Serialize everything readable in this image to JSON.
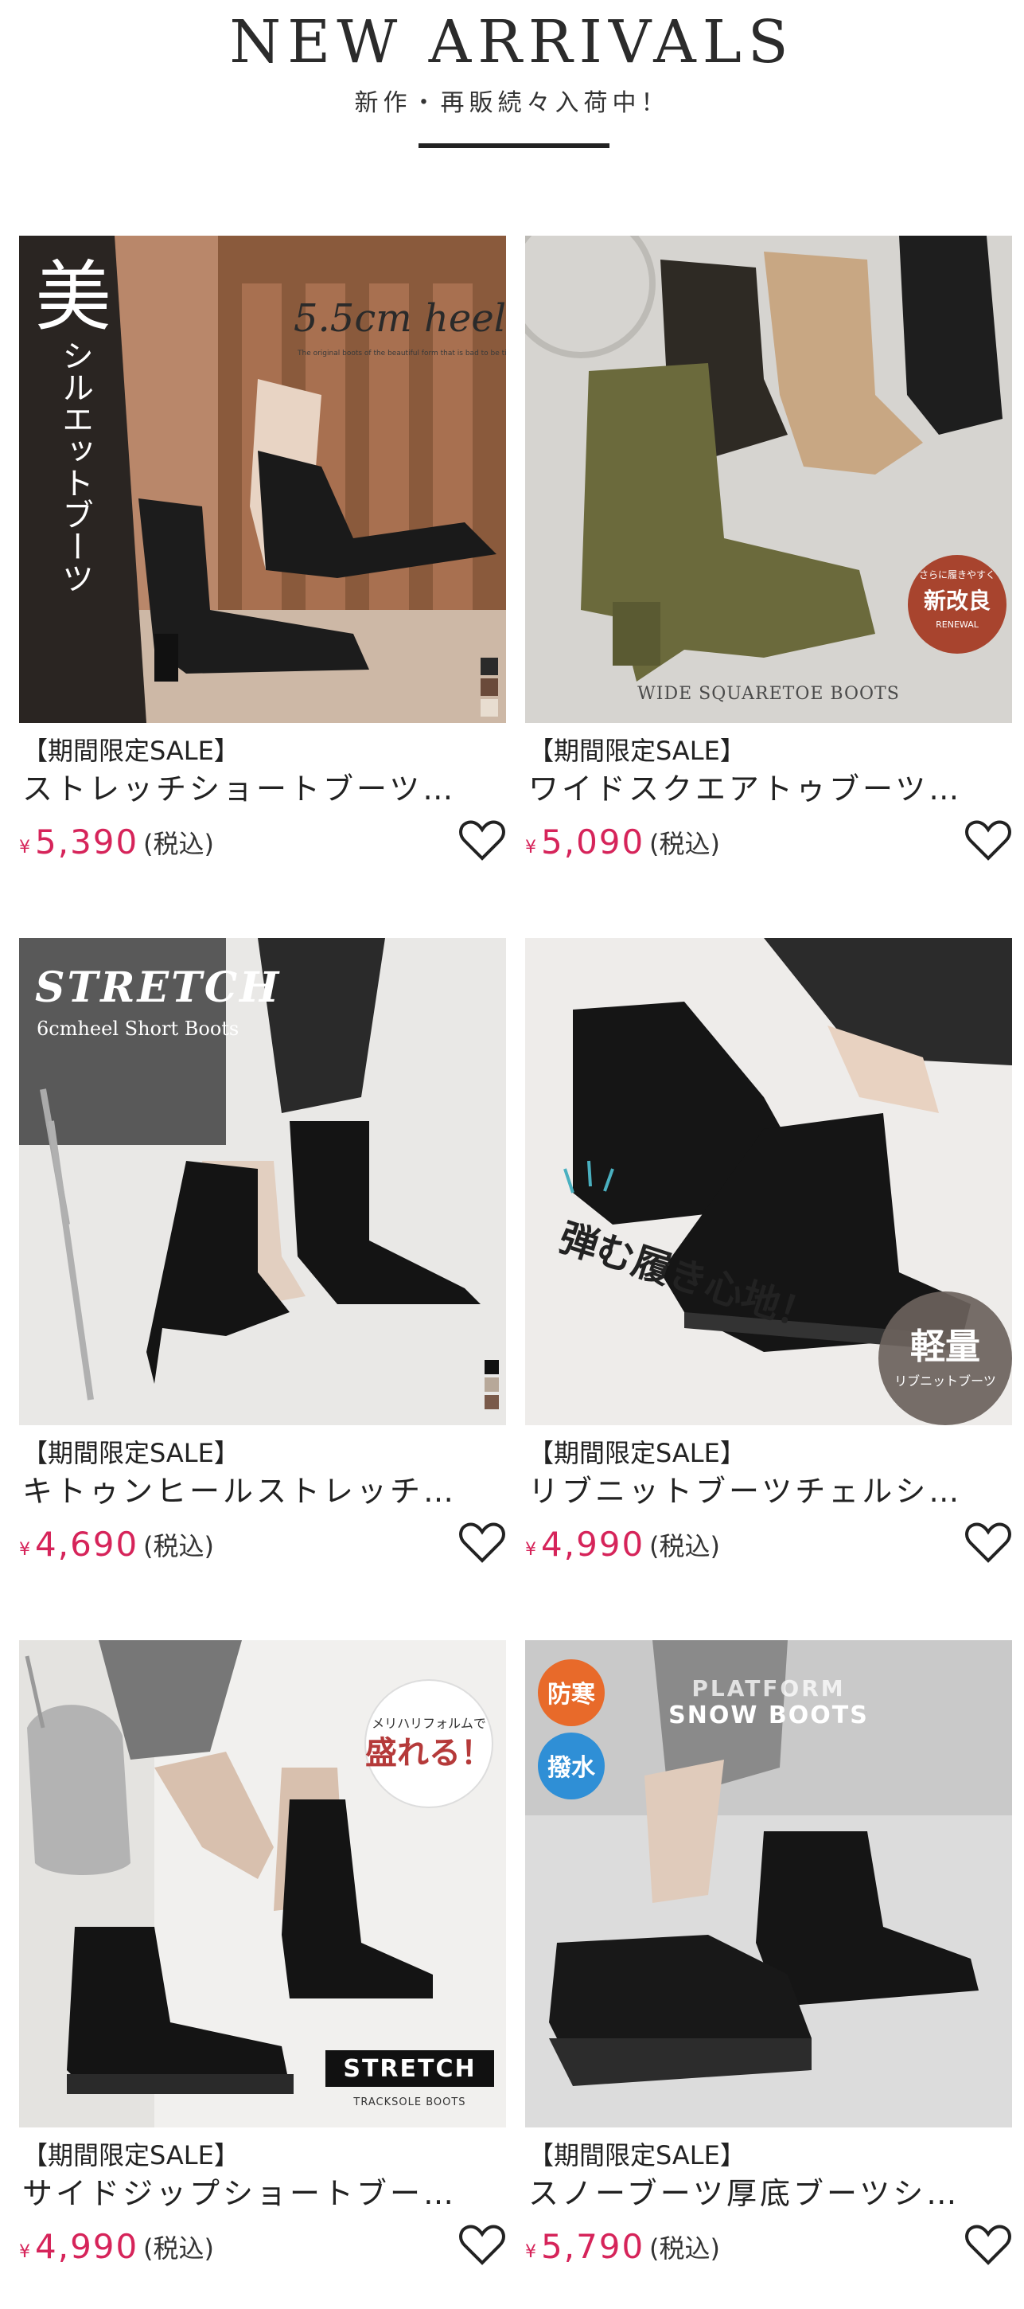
{
  "header": {
    "title": "NEW ARRIVALS",
    "subtitle": "新作・再販続々入荷中！"
  },
  "products": [
    {
      "tag": "【期間限定SALE】",
      "name": "ストレッチショートブーツ…",
      "yen": "¥",
      "price": "5,390",
      "tax": "(税込)",
      "image_text": {
        "big": "美",
        "vertical": "シルエットブーツ",
        "script": "5.5cm heel",
        "caption": "The original boots of the beautiful form that is bad to be tiring softly"
      }
    },
    {
      "tag": "【期間限定SALE】",
      "name": "ワイドスクエアトゥブーツ…",
      "yen": "¥",
      "price": "5,090",
      "tax": "(税込)",
      "image_text": {
        "badge_small": "さらに履きやすく",
        "badge_big": "新改良",
        "badge_sub": "RENEWAL",
        "caption": "WIDE SQUARETOE BOOTS"
      }
    },
    {
      "tag": "【期間限定SALE】",
      "name": "キトゥンヒールストレッチ…",
      "yen": "¥",
      "price": "4,690",
      "tax": "(税込)",
      "image_text": {
        "headline": "STRETCH",
        "sub": "6cmheel Short Boots"
      }
    },
    {
      "tag": "【期間限定SALE】",
      "name": "リブニットブーツチェルシ…",
      "yen": "¥",
      "price": "4,990",
      "tax": "(税込)",
      "image_text": {
        "slogan": "弾む履き心地！",
        "badge_big": "軽量",
        "badge_sub": "リブニットブーツ"
      }
    },
    {
      "tag": "【期間限定SALE】",
      "name": "サイドジップショートブー…",
      "yen": "¥",
      "price": "4,990",
      "tax": "(税込)",
      "image_text": {
        "bubble_small": "メリハリフォルムで",
        "bubble_big": "盛れる！",
        "label": "STRETCH",
        "label_sub": "TRACKSOLE BOOTS"
      }
    },
    {
      "tag": "【期間限定SALE】",
      "name": "スノーブーツ厚底ブーツシ…",
      "yen": "¥",
      "price": "5,790",
      "tax": "(税込)",
      "image_text": {
        "badge1": "防寒",
        "badge2": "撥水",
        "headline1": "PLATFORM",
        "headline2": "SNOW BOOTS"
      }
    }
  ],
  "colors": {
    "price": "#d6245a",
    "text": "#222222"
  },
  "icons": {
    "favorite": "heart-outline-icon"
  }
}
